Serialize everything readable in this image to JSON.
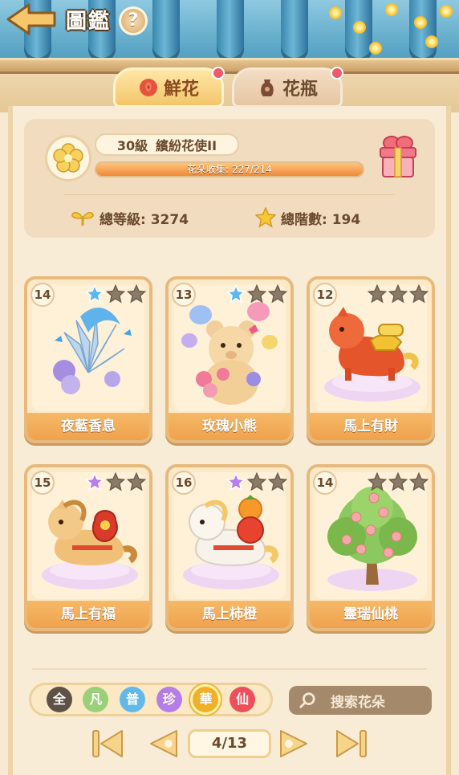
{
  "header": {
    "title": "圖鑑",
    "help_label": "?"
  },
  "tabs": [
    {
      "label": "鮮花",
      "active": true,
      "has_notification": true
    },
    {
      "label": "花瓶",
      "active": false,
      "has_notification": true
    }
  ],
  "profile": {
    "level": "30級",
    "rank_title": "繽紛花使II",
    "collection_text": "花朵收集: 227/214",
    "collection_progress": 1.0,
    "total_level_label": "總等級: 3274",
    "total_stars_label": "總階數: 194"
  },
  "cards": [
    {
      "name": "夜藍香息",
      "level": "14",
      "stars_filled": 1,
      "star_color": "#5bb8f0"
    },
    {
      "name": "玫瑰小熊",
      "level": "13",
      "stars_filled": 1,
      "star_color": "#5bb8f0"
    },
    {
      "name": "馬上有財",
      "level": "12",
      "stars_filled": 0,
      "star_color": "#8c7a68"
    },
    {
      "name": "馬上有福",
      "level": "15",
      "stars_filled": 1,
      "star_color": "#b77ef0"
    },
    {
      "name": "馬上柿橙",
      "level": "16",
      "stars_filled": 1,
      "star_color": "#b77ef0"
    },
    {
      "name": "靈瑞仙桃",
      "level": "14",
      "stars_filled": 0,
      "star_color": "#8c7a68"
    }
  ],
  "filters": [
    {
      "label": "全",
      "color": "#5e5246"
    },
    {
      "label": "凡",
      "color": "#9bd07a"
    },
    {
      "label": "普",
      "color": "#63b8ea"
    },
    {
      "label": "珍",
      "color": "#b47ee6"
    },
    {
      "label": "華",
      "color": "#f0b02a",
      "active": true
    },
    {
      "label": "仙",
      "color": "#ee4f5a"
    }
  ],
  "search": {
    "placeholder": "搜索花朵"
  },
  "pagination": {
    "page_label": "4/13"
  },
  "colors": {
    "accent": "#f0a04b",
    "panel": "#f8ecd6",
    "card_border": "#e8b97c"
  }
}
